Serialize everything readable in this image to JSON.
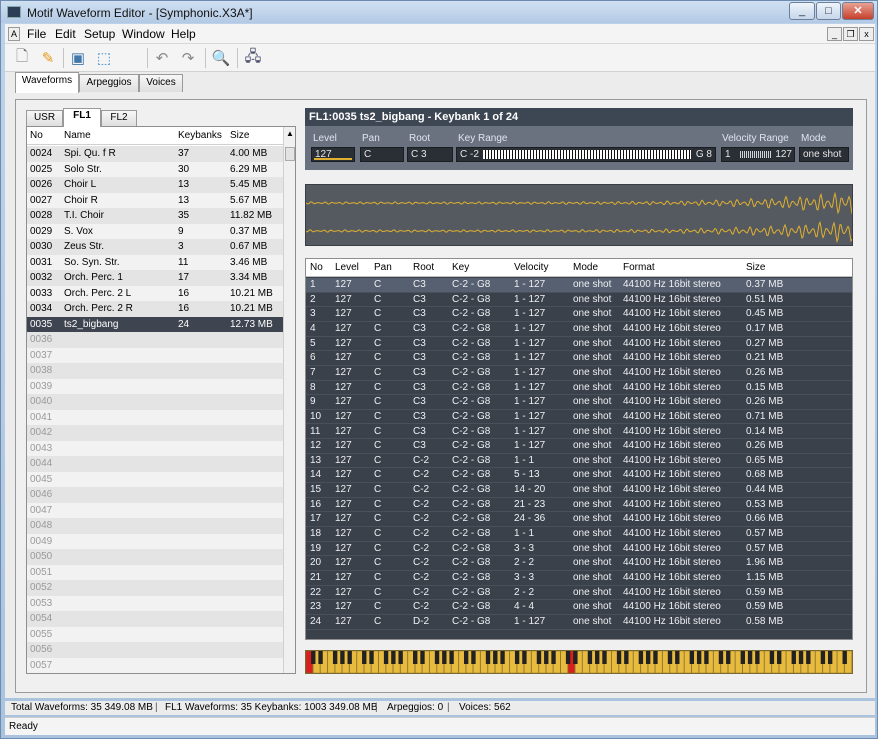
{
  "window": {
    "title": "Motif Waveform Editor - [Symphonic.X3A*]"
  },
  "menu": [
    "File",
    "Edit",
    "Setup",
    "Window",
    "Help"
  ],
  "tabs": [
    "Waveforms",
    "Arpeggios",
    "Voices"
  ],
  "subtabs": [
    "USR",
    "FL1",
    "FL2"
  ],
  "list": {
    "headers": [
      "No",
      "Name",
      "Keybanks",
      "Size"
    ],
    "rows": [
      [
        "0024",
        "Spi. Qu. f R",
        "37",
        "4.00 MB"
      ],
      [
        "0025",
        "Solo Str.",
        "30",
        "6.29 MB"
      ],
      [
        "0026",
        "Choir L",
        "13",
        "5.45 MB"
      ],
      [
        "0027",
        "Choir R",
        "13",
        "5.67 MB"
      ],
      [
        "0028",
        "T.I. Choir",
        "35",
        "11.82 MB"
      ],
      [
        "0029",
        "S. Vox",
        "9",
        "0.37 MB"
      ],
      [
        "0030",
        "Zeus Str.",
        "3",
        "0.67 MB"
      ],
      [
        "0031",
        "So. Syn. Str.",
        "11",
        "3.46 MB"
      ],
      [
        "0032",
        "Orch. Perc. 1",
        "17",
        "3.34 MB"
      ],
      [
        "0033",
        "Orch. Perc. 2 L",
        "16",
        "10.21 MB"
      ],
      [
        "0034",
        "Orch. Perc. 2 R",
        "16",
        "10.21 MB"
      ],
      [
        "0035",
        "ts2_bigbang",
        "24",
        "12.73 MB"
      ]
    ],
    "empty": [
      "0036",
      "0037",
      "0038",
      "0039",
      "0040",
      "0041",
      "0042",
      "0043",
      "0044",
      "0045",
      "0046",
      "0047",
      "0048",
      "0049",
      "0050",
      "0051",
      "0052",
      "0053",
      "0054",
      "0055",
      "0056",
      "0057"
    ]
  },
  "panel": {
    "header": "FL1:0035 ts2_bigbang - Keybank 1 of 24",
    "level_label": "Level",
    "level": "127",
    "pan_label": "Pan",
    "pan": "C",
    "root_label": "Root",
    "root": "C 3",
    "keyrange_label": "Key Range",
    "key_lo": "C -2",
    "key_hi": "G 8",
    "velrange_label": "Velocity Range",
    "vel_lo": "1",
    "vel_hi": "127",
    "mode_label": "Mode",
    "mode": "one shot"
  },
  "kb_table": {
    "headers": [
      "No",
      "Level",
      "Pan",
      "Root",
      "Key",
      "Velocity",
      "Mode",
      "Format",
      "Size"
    ],
    "rows": [
      [
        "1",
        "127",
        "C",
        "C3",
        "C-2 - G8",
        "1 - 127",
        "one shot",
        "44100 Hz  16bit  stereo",
        "0.37 MB"
      ],
      [
        "2",
        "127",
        "C",
        "C3",
        "C-2 - G8",
        "1 - 127",
        "one shot",
        "44100 Hz  16bit  stereo",
        "0.51 MB"
      ],
      [
        "3",
        "127",
        "C",
        "C3",
        "C-2 - G8",
        "1 - 127",
        "one shot",
        "44100 Hz  16bit  stereo",
        "0.45 MB"
      ],
      [
        "4",
        "127",
        "C",
        "C3",
        "C-2 - G8",
        "1 - 127",
        "one shot",
        "44100 Hz  16bit  stereo",
        "0.17 MB"
      ],
      [
        "5",
        "127",
        "C",
        "C3",
        "C-2 - G8",
        "1 - 127",
        "one shot",
        "44100 Hz  16bit  stereo",
        "0.27 MB"
      ],
      [
        "6",
        "127",
        "C",
        "C3",
        "C-2 - G8",
        "1 - 127",
        "one shot",
        "44100 Hz  16bit  stereo",
        "0.21 MB"
      ],
      [
        "7",
        "127",
        "C",
        "C3",
        "C-2 - G8",
        "1 - 127",
        "one shot",
        "44100 Hz  16bit  stereo",
        "0.26 MB"
      ],
      [
        "8",
        "127",
        "C",
        "C3",
        "C-2 - G8",
        "1 - 127",
        "one shot",
        "44100 Hz  16bit  stereo",
        "0.15 MB"
      ],
      [
        "9",
        "127",
        "C",
        "C3",
        "C-2 - G8",
        "1 - 127",
        "one shot",
        "44100 Hz  16bit  stereo",
        "0.26 MB"
      ],
      [
        "10",
        "127",
        "C",
        "C3",
        "C-2 - G8",
        "1 - 127",
        "one shot",
        "44100 Hz  16bit  stereo",
        "0.71 MB"
      ],
      [
        "11",
        "127",
        "C",
        "C3",
        "C-2 - G8",
        "1 - 127",
        "one shot",
        "44100 Hz  16bit  stereo",
        "0.14 MB"
      ],
      [
        "12",
        "127",
        "C",
        "C3",
        "C-2 - G8",
        "1 - 127",
        "one shot",
        "44100 Hz  16bit  stereo",
        "0.26 MB"
      ],
      [
        "13",
        "127",
        "C",
        "C-2",
        "C-2 - G8",
        "1 - 1",
        "one shot",
        "44100 Hz  16bit  stereo",
        "0.65 MB"
      ],
      [
        "14",
        "127",
        "C",
        "C-2",
        "C-2 - G8",
        "5 - 13",
        "one shot",
        "44100 Hz  16bit  stereo",
        "0.68 MB"
      ],
      [
        "15",
        "127",
        "C",
        "C-2",
        "C-2 - G8",
        "14 - 20",
        "one shot",
        "44100 Hz  16bit  stereo",
        "0.44 MB"
      ],
      [
        "16",
        "127",
        "C",
        "C-2",
        "C-2 - G8",
        "21 - 23",
        "one shot",
        "44100 Hz  16bit  stereo",
        "0.53 MB"
      ],
      [
        "17",
        "127",
        "C",
        "C-2",
        "C-2 - G8",
        "24 - 36",
        "one shot",
        "44100 Hz  16bit  stereo",
        "0.66 MB"
      ],
      [
        "18",
        "127",
        "C",
        "C-2",
        "C-2 - G8",
        "1 - 1",
        "one shot",
        "44100 Hz  16bit  stereo",
        "0.57 MB"
      ],
      [
        "19",
        "127",
        "C",
        "C-2",
        "C-2 - G8",
        "3 - 3",
        "one shot",
        "44100 Hz  16bit  stereo",
        "0.57 MB"
      ],
      [
        "20",
        "127",
        "C",
        "C-2",
        "C-2 - G8",
        "2 - 2",
        "one shot",
        "44100 Hz  16bit  stereo",
        "1.96 MB"
      ],
      [
        "21",
        "127",
        "C",
        "C-2",
        "C-2 - G8",
        "3 - 3",
        "one shot",
        "44100 Hz  16bit  stereo",
        "1.15 MB"
      ],
      [
        "22",
        "127",
        "C",
        "C-2",
        "C-2 - G8",
        "2 - 2",
        "one shot",
        "44100 Hz  16bit  stereo",
        "0.59 MB"
      ],
      [
        "23",
        "127",
        "C",
        "C-2",
        "C-2 - G8",
        "4 - 4",
        "one shot",
        "44100 Hz  16bit  stereo",
        "0.59 MB"
      ],
      [
        "24",
        "127",
        "C",
        "D-2",
        "C-2 - G8",
        "1 - 127",
        "one shot",
        "44100 Hz  16bit  stereo",
        "0.58 MB"
      ]
    ]
  },
  "status": {
    "total": "Total Waveforms: 35   349.08 MB",
    "fl1": "FL1  Waveforms: 35   Keybanks: 1003   349.08 MB",
    "arp": "Arpeggios: 0",
    "voices": "Voices: 562",
    "ready": "Ready"
  },
  "colors": {
    "accent": "#e0b030",
    "selected_row": "#3e4450",
    "dark_panel": "#3b414b"
  },
  "icons": [
    "new-file-icon",
    "open-icon",
    "save-icon",
    "import-icon",
    "undo-icon",
    "redo-icon",
    "search-icon",
    "device-icon"
  ]
}
